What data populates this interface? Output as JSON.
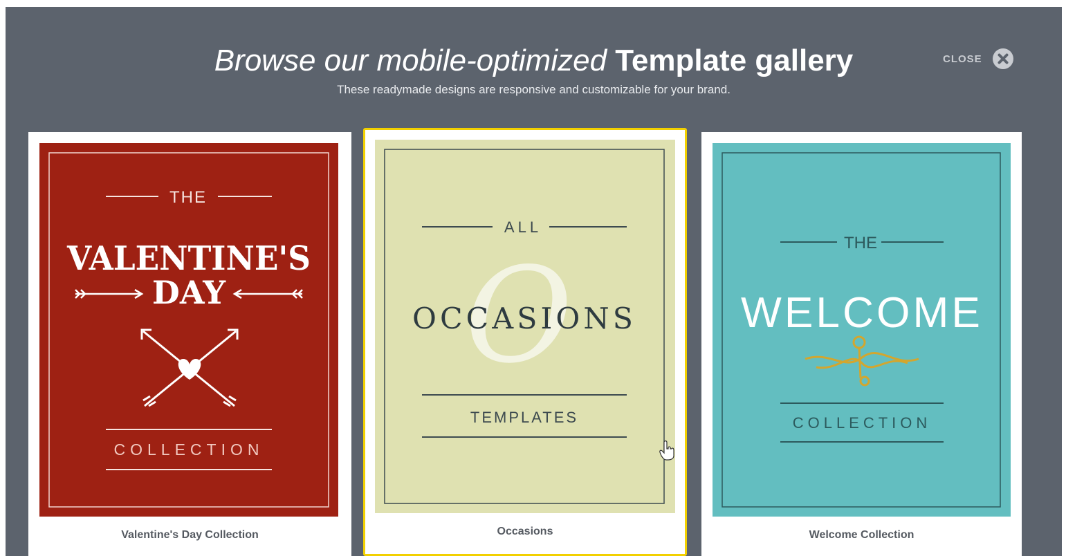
{
  "modal": {
    "title_light": "Browse our mobile-optimized",
    "title_bold": "Template gallery",
    "subtitle": "These readymade designs are responsive and customizable for your brand.",
    "close_label": "CLOSE",
    "close_icon": "close-circle-icon"
  },
  "colors": {
    "overlay": "#5c636d",
    "selected_border": "#f2d000",
    "valentine_bg": "#9e2113",
    "occasions_bg": "#dfe1b1",
    "welcome_bg": "#63bec0",
    "welcome_flourish": "#d3a62e"
  },
  "templates": [
    {
      "caption": "Valentine's Day Collection",
      "art": {
        "top": "THE",
        "title_line1": "VALENTINE'S",
        "title_line2": "DAY",
        "bottom": "COLLECTION"
      }
    },
    {
      "caption": "Occasions",
      "selected": true,
      "art": {
        "top": "ALL",
        "script_letter": "O",
        "title": "OCCASIONS",
        "bottom": "TEMPLATES"
      }
    },
    {
      "caption": "Welcome Collection",
      "art": {
        "top": "THE",
        "title": "WELCOME",
        "bottom": "COLLECTION"
      }
    }
  ]
}
